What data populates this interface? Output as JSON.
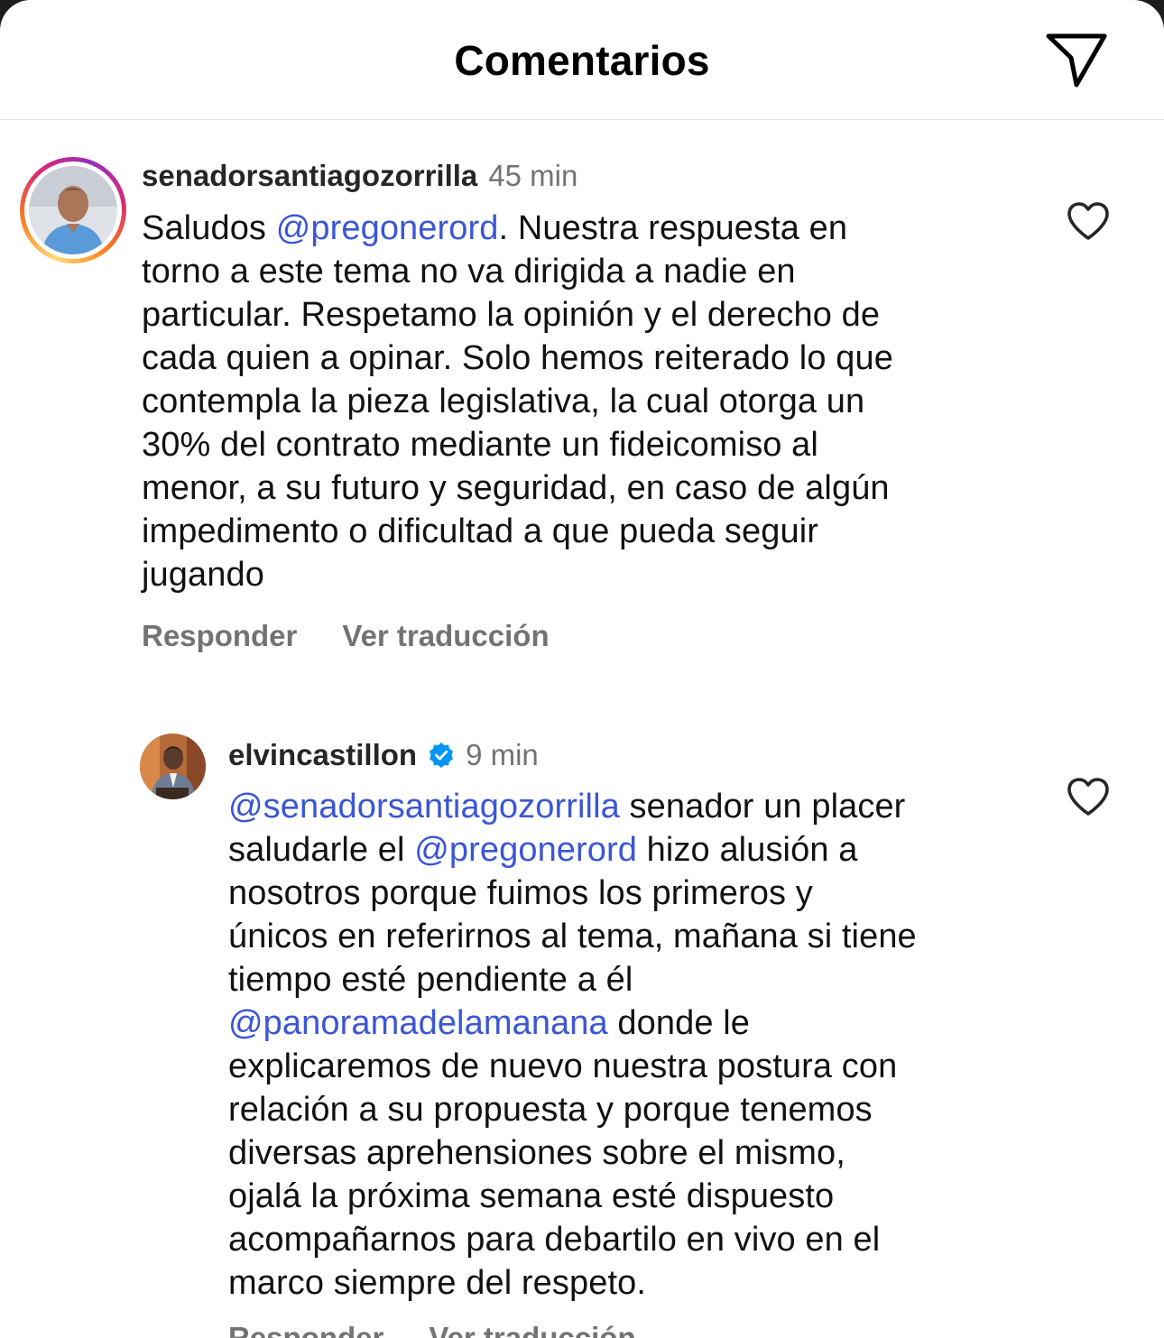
{
  "header": {
    "title": "Comentarios",
    "share_icon": "send-icon"
  },
  "comments": [
    {
      "username": "senadorsantiagozorrilla",
      "time": "45 min",
      "verified": false,
      "has_story_ring": true,
      "lines": [
        [
          "Saludos ",
          {
            "mention": "@pregonerord"
          },
          ". Nuestra respuesta en"
        ],
        [
          "torno a este tema no va dirigida a nadie en"
        ],
        [
          "particular. Respetamo la opinión y el derecho de"
        ],
        [
          "cada quien a opinar. Solo hemos reiterado lo que"
        ],
        [
          "contempla la pieza legislativa, la cual otorga un"
        ],
        [
          "30% del contrato mediante un fideicomiso al"
        ],
        [
          "menor, a su futuro y seguridad, en caso de algún"
        ],
        [
          "impedimento o dificultad a que pueda seguir"
        ],
        [
          "jugando"
        ]
      ],
      "reply_label": "Responder",
      "translate_label": "Ver traducción",
      "like_icon": "heart-icon"
    },
    {
      "username": "elvincastillon",
      "time": "9 min",
      "verified": true,
      "has_story_ring": false,
      "lines": [
        [
          {
            "mention": "@senadorsantiagozorrilla"
          },
          " senador un placer"
        ],
        [
          "saludarle el ",
          {
            "mention": "@pregonerord"
          },
          " hizo alusión a"
        ],
        [
          "nosotros porque fuimos los primeros y"
        ],
        [
          "únicos en referirnos al tema, mañana si tiene"
        ],
        [
          "tiempo esté pendiente a él"
        ],
        [
          {
            "mention": "@panoramadelamanana"
          },
          " donde le"
        ],
        [
          "explicaremos de nuevo nuestra postura con"
        ],
        [
          "relación a su propuesta y porque tenemos"
        ],
        [
          "diversas aprehensiones sobre el mismo,"
        ],
        [
          "ojalá la próxima semana esté dispuesto"
        ],
        [
          "acompañarnos para debartilo en vivo en el"
        ],
        [
          "marco siempre del respeto."
        ]
      ],
      "reply_label": "Responder",
      "translate_label": "Ver traducción",
      "like_icon": "heart-icon"
    }
  ],
  "colors": {
    "mention": "#3b56d6",
    "secondary_text": "#737373",
    "verified_badge": "#0095f6"
  }
}
